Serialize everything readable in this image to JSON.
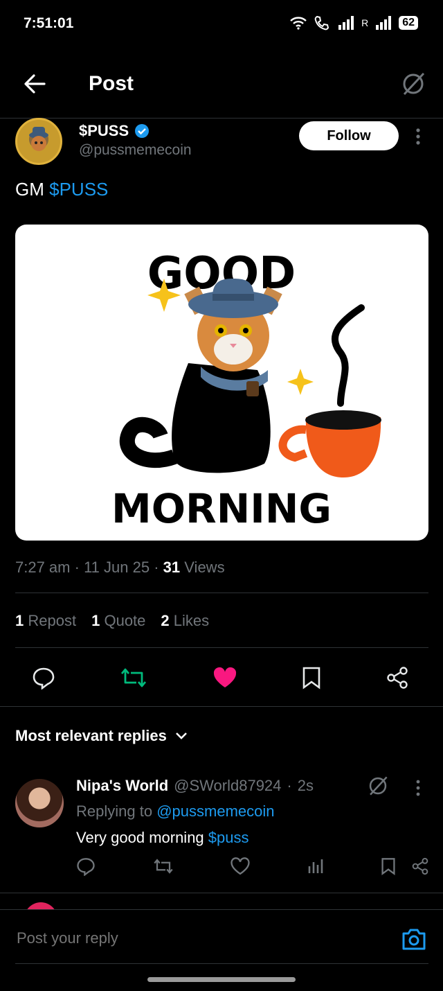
{
  "status_bar": {
    "time": "7:51:01",
    "battery": "62",
    "roaming_label": "R"
  },
  "header": {
    "title": "Post"
  },
  "post": {
    "display_name": "$PUSS",
    "handle": "@pussmemecoin",
    "follow_label": "Follow",
    "text_prefix": "GM",
    "text_tag": "$PUSS",
    "image": {
      "top_text": "GOOD",
      "bottom_text": "MORNING"
    },
    "time": "7:27 am",
    "date": "11 Jun 25",
    "views_count": "31",
    "views_label": "Views",
    "reposts_count": "1",
    "reposts_label": "Repost",
    "quotes_count": "1",
    "quotes_label": "Quote",
    "likes_count": "2",
    "likes_label": "Likes"
  },
  "replies_section": {
    "sort_label": "Most relevant replies"
  },
  "reply": {
    "display_name": "Nipa's World",
    "handle": "@SWorld87924",
    "time": "2s",
    "replying_prefix": "Replying to",
    "replying_to": "@pussmemecoin",
    "text_main": "Very good morning",
    "text_tag": "$puss"
  },
  "composer": {
    "placeholder": "Post your reply"
  },
  "colors": {
    "accent": "#1d9bf0",
    "repost_active": "#00ba7c",
    "like_active": "#f91880"
  }
}
